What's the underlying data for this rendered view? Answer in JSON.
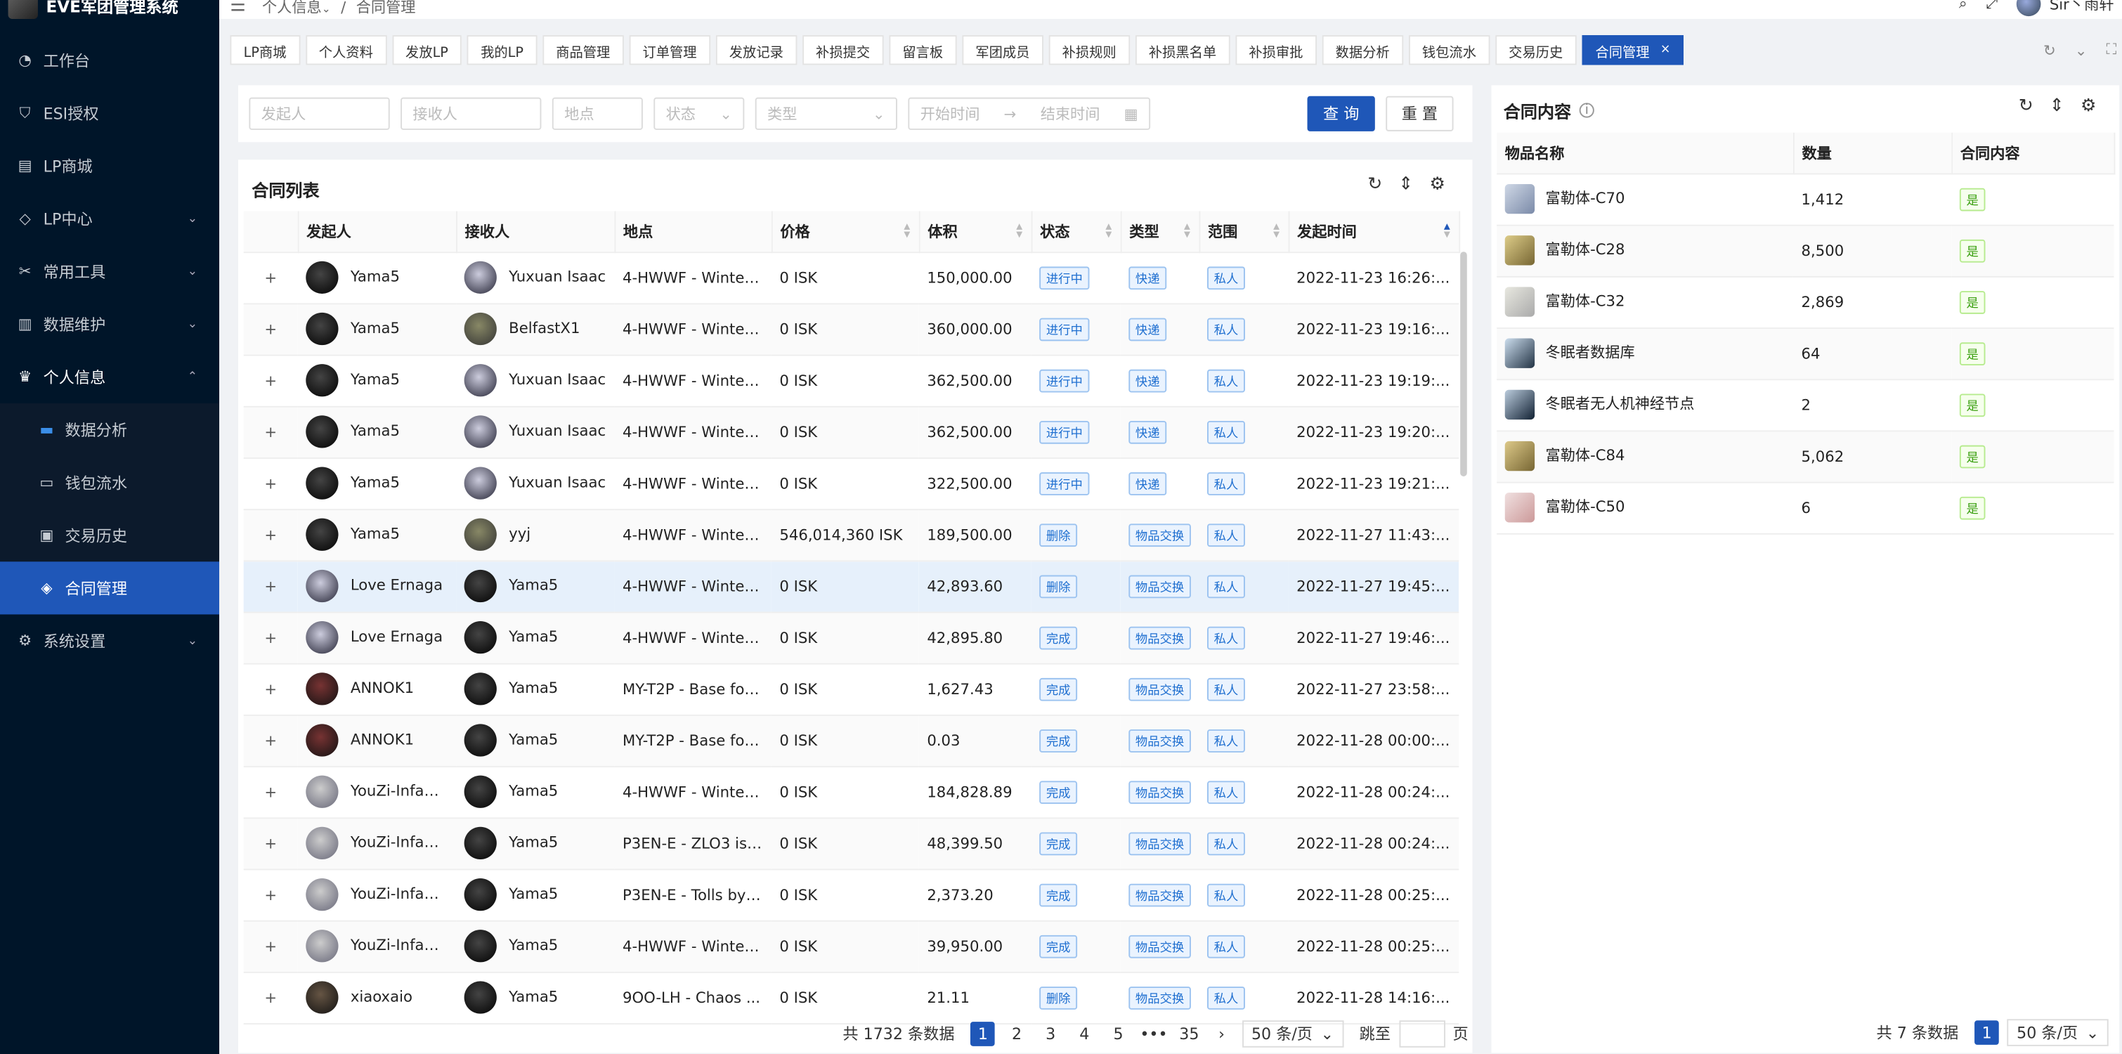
{
  "app": {
    "title": "EVE军团管理系统",
    "user": "Sir丶雨轩"
  },
  "breadcrumb": [
    "个人信息",
    "合同管理"
  ],
  "sidebar": [
    {
      "label": "工作台",
      "icon": "dashboard-icon"
    },
    {
      "label": "ESI授权",
      "icon": "shield-icon"
    },
    {
      "label": "LP商城",
      "icon": "store-icon"
    },
    {
      "label": "LP中心",
      "icon": "tag-icon",
      "arrow": "⌄"
    },
    {
      "label": "常用工具",
      "icon": "tools-icon",
      "arrow": "⌄"
    },
    {
      "label": "数据维护",
      "icon": "database-icon",
      "arrow": "⌄"
    },
    {
      "label": "个人信息",
      "icon": "user-icon",
      "arrow": "⌃"
    }
  ],
  "submenu": [
    {
      "label": "数据分析",
      "icon": "chart-icon"
    },
    {
      "label": "钱包流水",
      "icon": "wallet-icon"
    },
    {
      "label": "交易历史",
      "icon": "history-icon"
    },
    {
      "label": "合同管理",
      "icon": "contract-icon"
    }
  ],
  "settings": {
    "label": "系统设置"
  },
  "tabs": [
    "LP商城",
    "个人资料",
    "发放LP",
    "我的LP",
    "商品管理",
    "订单管理",
    "发放记录",
    "补损提交",
    "留言板",
    "军团成员",
    "补损规则",
    "补损黑名单",
    "补损审批",
    "数据分析",
    "钱包流水",
    "交易历史",
    "合同管理"
  ],
  "filters": {
    "issuer": "发起人",
    "receiver": "接收人",
    "location": "地点",
    "status": "状态",
    "type": "类型",
    "start": "开始时间",
    "end": "结束时间",
    "query": "查 询",
    "reset": "重 置"
  },
  "list": {
    "title": "合同列表",
    "headers": [
      "发起人",
      "接收人",
      "地点",
      "价格",
      "体积",
      "状态",
      "类型",
      "范围",
      "发起时间"
    ],
    "rows": [
      [
        "Yama5",
        "Yuxuan Isaac",
        "4-HWWF - Winter...",
        "0 ISK",
        "150,000.00",
        "进行中",
        "快递",
        "私人",
        "2022-11-23 16:26:..."
      ],
      [
        "Yama5",
        "BelfastX1",
        "4-HWWF - Winter...",
        "0 ISK",
        "360,000.00",
        "进行中",
        "快递",
        "私人",
        "2022-11-23 19:16:..."
      ],
      [
        "Yama5",
        "Yuxuan Isaac",
        "4-HWWF - Winter...",
        "0 ISK",
        "362,500.00",
        "进行中",
        "快递",
        "私人",
        "2022-11-23 19:19:..."
      ],
      [
        "Yama5",
        "Yuxuan Isaac",
        "4-HWWF - Winter...",
        "0 ISK",
        "362,500.00",
        "进行中",
        "快递",
        "私人",
        "2022-11-23 19:20:..."
      ],
      [
        "Yama5",
        "Yuxuan Isaac",
        "4-HWWF - Winter...",
        "0 ISK",
        "322,500.00",
        "进行中",
        "快递",
        "私人",
        "2022-11-23 19:21:..."
      ],
      [
        "Yama5",
        "yyj",
        "4-HWWF - Winter...",
        "546,014,360 ISK",
        "189,500.00",
        "删除",
        "物品交换",
        "私人",
        "2022-11-27 11:43:..."
      ],
      [
        "Love Ernaga",
        "Yama5",
        "4-HWWF - Winter...",
        "0 ISK",
        "42,893.60",
        "删除",
        "物品交换",
        "私人",
        "2022-11-27 19:45:..."
      ],
      [
        "Love Ernaga",
        "Yama5",
        "4-HWWF - Winter...",
        "0 ISK",
        "42,895.80",
        "完成",
        "物品交换",
        "私人",
        "2022-11-27 19:46:..."
      ],
      [
        "ANNOK1",
        "Yama5",
        "MY-T2P - Base for...",
        "0 ISK",
        "1,627.43",
        "完成",
        "物品交换",
        "私人",
        "2022-11-27 23:58:..."
      ],
      [
        "ANNOK1",
        "Yama5",
        "MY-T2P - Base for...",
        "0 ISK",
        "0.03",
        "完成",
        "物品交换",
        "私人",
        "2022-11-28 00:00:..."
      ],
      [
        "YouZi-Infant...",
        "Yama5",
        "4-HWWF - Winter...",
        "0 ISK",
        "184,828.89",
        "完成",
        "物品交换",
        "私人",
        "2022-11-28 00:24:..."
      ],
      [
        "YouZi-Infant...",
        "Yama5",
        "P3EN-E - ZLO3 is ...",
        "0 ISK",
        "48,399.50",
        "完成",
        "物品交换",
        "私人",
        "2022-11-28 00:24:..."
      ],
      [
        "YouZi-Infant...",
        "Yama5",
        "P3EN-E - Tolls by ...",
        "0 ISK",
        "2,373.20",
        "完成",
        "物品交换",
        "私人",
        "2022-11-28 00:25:..."
      ],
      [
        "YouZi-Infant...",
        "Yama5",
        "4-HWWF - Winter...",
        "0 ISK",
        "39,950.00",
        "完成",
        "物品交换",
        "私人",
        "2022-11-28 00:25:..."
      ],
      [
        "xiaoxaio",
        "Yama5",
        "9OO-LH - Chaos ...",
        "0 ISK",
        "21.11",
        "删除",
        "物品交换",
        "私人",
        "2022-11-28 14:16:..."
      ]
    ],
    "total": "共 1732 条数据",
    "pages": [
      "1",
      "2",
      "3",
      "4",
      "5",
      "•••",
      "35"
    ],
    "page_size": "50 条/页",
    "jump": "跳至",
    "page_unit": "页"
  },
  "content": {
    "title": "合同内容",
    "headers": [
      "物品名称",
      "数量",
      "合同内容"
    ],
    "rows": [
      [
        "富勒体-C70",
        "1,412",
        "是"
      ],
      [
        "富勒体-C28",
        "8,500",
        "是"
      ],
      [
        "富勒体-C32",
        "2,869",
        "是"
      ],
      [
        "冬眠者数据库",
        "64",
        "是"
      ],
      [
        "冬眠者无人机神经节点",
        "2",
        "是"
      ],
      [
        "富勒体-C84",
        "5,062",
        "是"
      ],
      [
        "富勒体-C50",
        "6",
        "是"
      ]
    ],
    "total": "共 7 条数据",
    "page": "1",
    "page_size": "50 条/页"
  }
}
